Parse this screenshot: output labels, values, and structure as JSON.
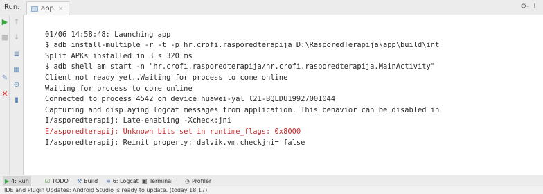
{
  "header": {
    "run_label": "Run:",
    "tab_label": "app",
    "tab_close": "×",
    "gear": "⚙- ⊥"
  },
  "colors": {
    "run_green": "#3aa845",
    "stop_red": "#d9362f",
    "error_text": "#c02a2a",
    "panel_bg": "#ececec"
  },
  "toolbar1_icons": [
    "run-icon",
    "stop-icon",
    "pin-icon",
    "close-icon"
  ],
  "toolbar2_icons": [
    "up-arrow-icon",
    "down-arrow-icon",
    "soft-wrap-icon",
    "print-icon",
    "settings-icon",
    "trash-icon"
  ],
  "console": {
    "lines": [
      {
        "text": "",
        "type": "blank"
      },
      {
        "text": "01/06 14:58:48: Launching app",
        "type": "normal"
      },
      {
        "text": "$ adb install-multiple -r -t -p hr.crofi.rasporedterapija D:\\RasporedTerapija\\app\\build\\int",
        "type": "normal"
      },
      {
        "text": "Split APKs installed in 3 s 320 ms",
        "type": "normal"
      },
      {
        "text": "$ adb shell am start -n \"hr.crofi.rasporedterapija/hr.crofi.rasporedterapija.MainActivity\"",
        "type": "normal"
      },
      {
        "text": "Client not ready yet..Waiting for process to come online",
        "type": "normal"
      },
      {
        "text": "Waiting for process to come online",
        "type": "normal"
      },
      {
        "text": "Connected to process 4542 on device huawei-yal_l21-BQLDU19927001044",
        "type": "normal"
      },
      {
        "text": "Capturing and displaying logcat messages from application. This behavior can be disabled in",
        "type": "normal"
      },
      {
        "text": "I/asporedterapij: Late-enabling -Xcheck:jni",
        "type": "normal"
      },
      {
        "text": "E/asporedterapij: Unknown bits set in runtime_flags: 0x8000",
        "type": "error"
      },
      {
        "text": "I/asporedterapij: Reinit property: dalvik.vm.checkjni= false",
        "type": "normal"
      }
    ]
  },
  "bottombar": {
    "run": "4: Run",
    "todo": "TODO",
    "build": "Build",
    "logcat": "6: Logcat",
    "terminal": "Terminal",
    "profiler": "Profiler"
  },
  "status": {
    "text": "IDE and Plugin Updates: Android Studio is ready to update. (today 18:17)"
  }
}
